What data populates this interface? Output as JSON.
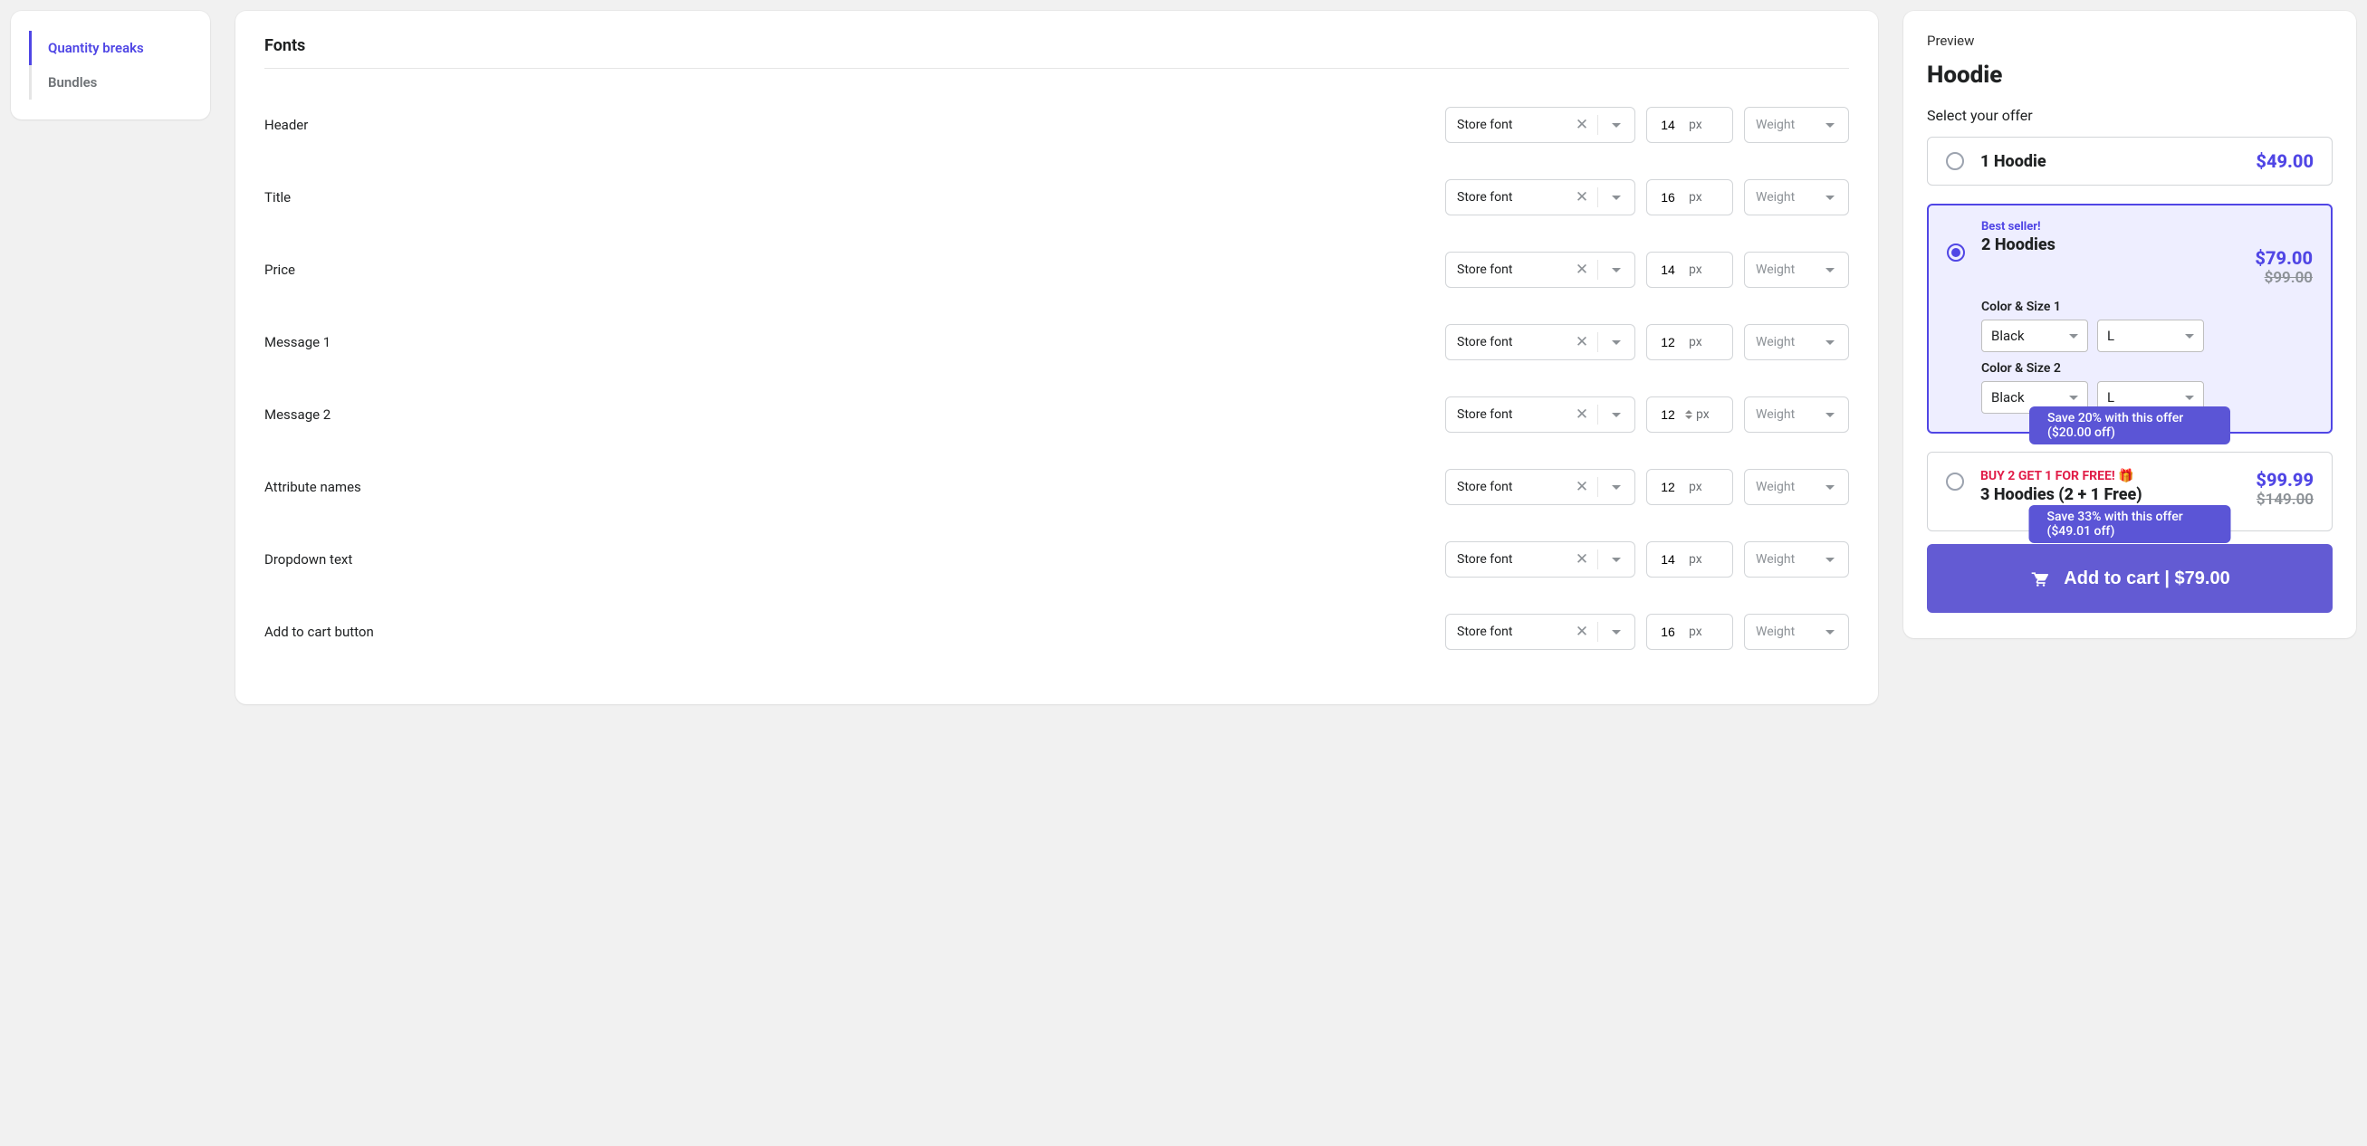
{
  "sidebar": {
    "items": [
      {
        "label": "Quantity breaks",
        "active": true
      },
      {
        "label": "Bundles",
        "active": false
      }
    ]
  },
  "fonts": {
    "section_title": "Fonts",
    "unit": "px",
    "weight_placeholder": "Weight",
    "rows": [
      {
        "label": "Header",
        "font": "Store font",
        "size": "14"
      },
      {
        "label": "Title",
        "font": "Store font",
        "size": "16"
      },
      {
        "label": "Price",
        "font": "Store font",
        "size": "14"
      },
      {
        "label": "Message 1",
        "font": "Store font",
        "size": "12"
      },
      {
        "label": "Message 2",
        "font": "Store font",
        "size": "12",
        "spinner": true
      },
      {
        "label": "Attribute names",
        "font": "Store font",
        "size": "12"
      },
      {
        "label": "Dropdown text",
        "font": "Store font",
        "size": "14"
      },
      {
        "label": "Add to cart button",
        "font": "Store font",
        "size": "16"
      }
    ]
  },
  "preview": {
    "header": "Preview",
    "product": "Hoodie",
    "select_label": "Select your offer",
    "offers": {
      "one": {
        "title": "1 Hoodie",
        "price": "$49.00"
      },
      "two": {
        "badge": "Best seller!",
        "title": "2 Hoodies",
        "price": "$79.00",
        "old_price": "$99.00",
        "variant1_label": "Color & Size 1",
        "variant2_label": "Color & Size 2",
        "color": "Black",
        "size": "L",
        "save": "Save 20% with this offer ($20.00 off)"
      },
      "three": {
        "badge": "BUY 2 GET 1 FOR FREE! 🎁",
        "title": "3 Hoodies (2 + 1 Free)",
        "price": "$99.99",
        "old_price": "$149.00",
        "save": "Save 33% with this offer ($49.01 off)"
      }
    },
    "add_to_cart": "Add to cart | $79.00"
  }
}
